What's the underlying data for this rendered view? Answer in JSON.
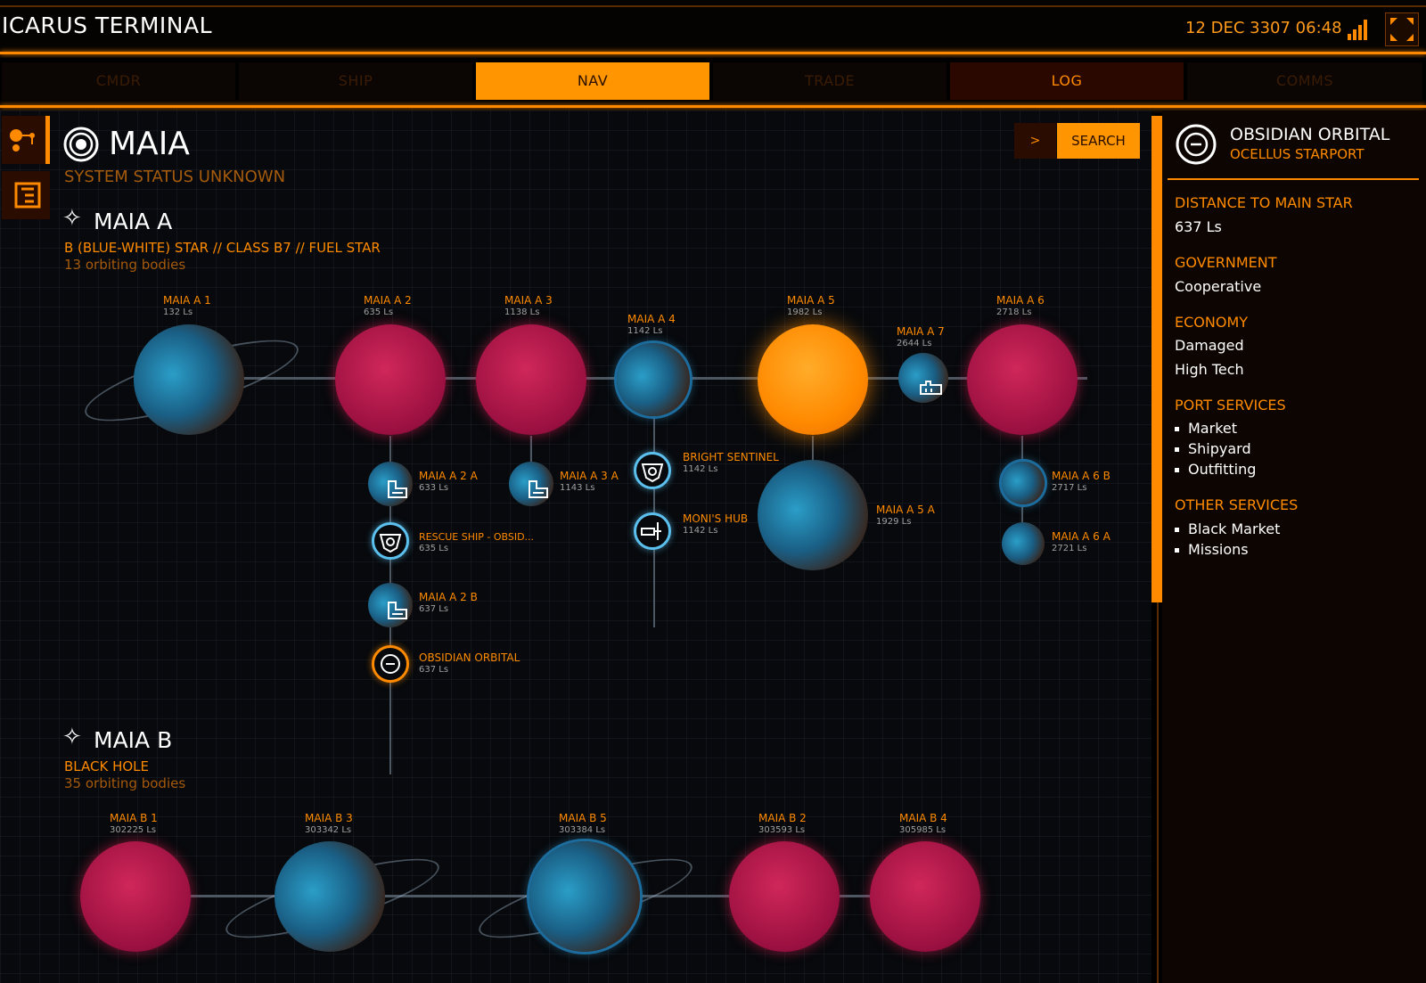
{
  "app": {
    "title": "ICARUS TERMINAL",
    "datetime": "12 DEC 3307 06:48"
  },
  "tabs": [
    {
      "label": "CMDR"
    },
    {
      "label": "SHIP"
    },
    {
      "label": "NAV"
    },
    {
      "label": "TRADE"
    },
    {
      "label": "LOG"
    },
    {
      "label": "COMMS"
    }
  ],
  "active_tab": "NAV",
  "system": {
    "name": "MAIA",
    "status": "SYSTEM STATUS UNKNOWN"
  },
  "search": {
    "prompt": ">",
    "label": "SEARCH"
  },
  "star_a": {
    "name": "MAIA A",
    "class": "B (BLUE-WHITE) STAR // CLASS B7 // FUEL STAR",
    "bodies_count": "13 orbiting bodies",
    "bodies": [
      {
        "name": "MAIA A 1",
        "dist": "132 Ls"
      },
      {
        "name": "MAIA A 2",
        "dist": "635 Ls"
      },
      {
        "name": "MAIA A 3",
        "dist": "1138 Ls"
      },
      {
        "name": "MAIA A 4",
        "dist": "1142 Ls"
      },
      {
        "name": "MAIA A 5",
        "dist": "1982 Ls"
      },
      {
        "name": "MAIA A 7",
        "dist": "2644 Ls"
      },
      {
        "name": "MAIA A 6",
        "dist": "2718 Ls"
      },
      {
        "name": "MAIA A 2 A",
        "dist": "633 Ls"
      },
      {
        "name": "RESCUE SHIP - OBSID...",
        "dist": "635 Ls"
      },
      {
        "name": "MAIA A 2 B",
        "dist": "637 Ls"
      },
      {
        "name": "OBSIDIAN ORBITAL",
        "dist": "637 Ls"
      },
      {
        "name": "MAIA A 3 A",
        "dist": "1143 Ls"
      },
      {
        "name": "BRIGHT SENTINEL",
        "dist": "1142 Ls"
      },
      {
        "name": "MONI'S HUB",
        "dist": "1142 Ls"
      },
      {
        "name": "MAIA A 5 A",
        "dist": "1929 Ls"
      },
      {
        "name": "MAIA A 6 B",
        "dist": "2717 Ls"
      },
      {
        "name": "MAIA A 6 A",
        "dist": "2721 Ls"
      }
    ]
  },
  "star_b": {
    "name": "MAIA B",
    "class": "BLACK HOLE",
    "bodies_count": "35 orbiting bodies",
    "bodies": [
      {
        "name": "MAIA B 1",
        "dist": "302225 Ls"
      },
      {
        "name": "MAIA B 3",
        "dist": "303342 Ls"
      },
      {
        "name": "MAIA B 5",
        "dist": "303384 Ls"
      },
      {
        "name": "MAIA B 2",
        "dist": "303593 Ls"
      },
      {
        "name": "MAIA B 4",
        "dist": "305985 Ls"
      }
    ]
  },
  "selected": {
    "name": "OBSIDIAN ORBITAL",
    "type": "OCELLUS STARPORT",
    "distance_label": "DISTANCE TO MAIN STAR",
    "distance": "637 Ls",
    "government_label": "GOVERNMENT",
    "government": "Cooperative",
    "economy_label": "ECONOMY",
    "economy": [
      "Damaged",
      "High Tech"
    ],
    "port_services_label": "PORT SERVICES",
    "port_services": [
      "Market",
      "Shipyard",
      "Outfitting"
    ],
    "other_services_label": "OTHER SERVICES",
    "other_services": [
      "Black Market",
      "Missions"
    ]
  },
  "colors": {
    "accent": "#ff8a00",
    "planet_red": "#c0204f",
    "planet_blue": "#2a9ec8"
  }
}
